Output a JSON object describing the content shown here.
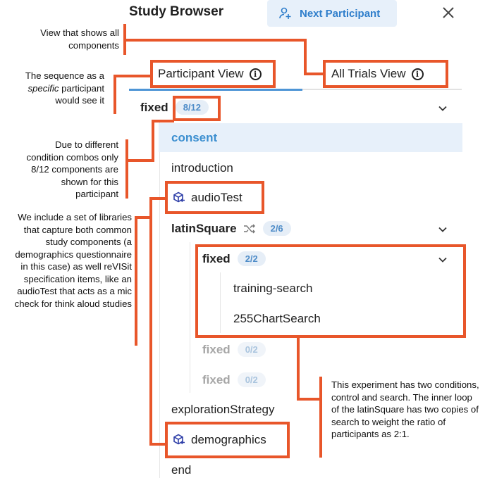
{
  "header": {
    "title": "Study Browser",
    "next_participant_label": "Next Participant",
    "icons": {
      "next": "user-plus-icon",
      "close": "close-icon"
    }
  },
  "tabs": [
    {
      "label": "Participant View",
      "active": true
    },
    {
      "label": "All Trials View",
      "active": false
    }
  ],
  "tree": {
    "root": {
      "label": "fixed",
      "badge": "8/12"
    },
    "items": {
      "consent": "consent",
      "introduction": "introduction",
      "audiotest": "audioTest",
      "latinsquare": "latinSquare",
      "latinsquare_badge": "2/6",
      "inner_fixed": "fixed",
      "inner_fixed_badge": "2/2",
      "training_search": "training-search",
      "chart_search": "255ChartSearch",
      "fixed_a": "fixed",
      "fixed_a_badge": "0/2",
      "fixed_b": "fixed",
      "fixed_b_badge": "0/2",
      "exploration": "explorationStrategy",
      "demographics": "demographics",
      "end": "end"
    }
  },
  "annotations": {
    "all_components": "View that shows all components",
    "sequence_pre": "The sequence as a ",
    "sequence_em": "specific",
    "sequence_post": " participant would see it",
    "condition_combos": "Due to different condition combos only 8/12 components are shown for this participant",
    "libraries": "We include a set of libraries that capture both common study components (a demographics questionnaire in this case) as well reVISit specification items, like an audioTest that acts as a mic check for think aloud studies",
    "experiment": "This experiment has two conditions, control and search. The inner loop of the latinSquare has two copies of search to weight the ratio of participants as 2:1."
  },
  "colors": {
    "accent": "#2f7ecb",
    "callout": "#e8562a",
    "highlight": "#e7f0fa"
  }
}
